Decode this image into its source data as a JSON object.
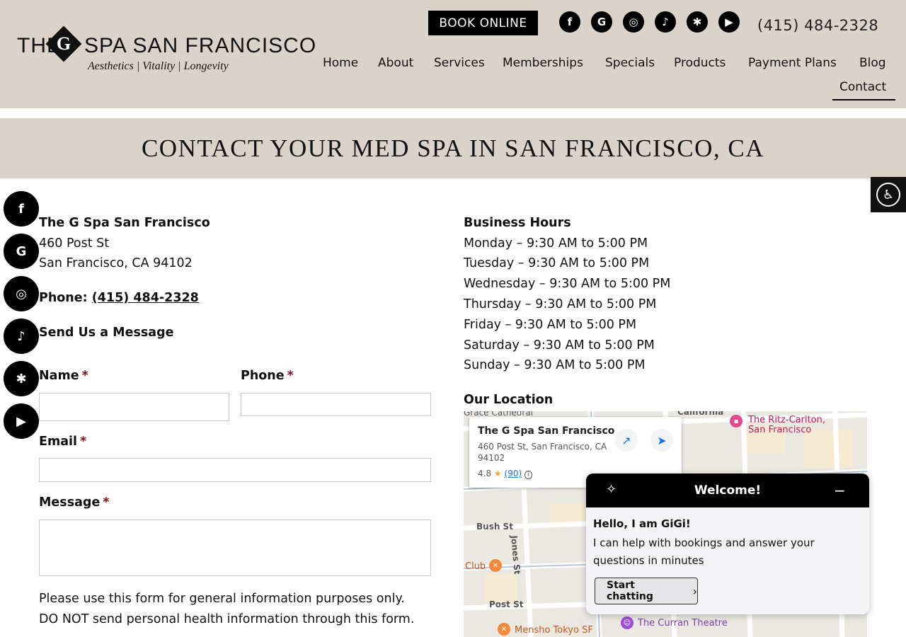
{
  "header": {
    "logo": {
      "the": "THE",
      "g": "G",
      "rest": "SPA SAN FRANCISCO",
      "tagline": "Aesthetics | Vitality | Longevity"
    },
    "book_online": "BOOK ONLINE",
    "phone": "(415) 484-2328",
    "social_icons": [
      {
        "name": "facebook-icon",
        "glyph": "f"
      },
      {
        "name": "google-icon",
        "glyph": "G"
      },
      {
        "name": "instagram-icon",
        "glyph": "◎"
      },
      {
        "name": "tiktok-icon",
        "glyph": "♪"
      },
      {
        "name": "yelp-icon",
        "glyph": "✱"
      },
      {
        "name": "youtube-icon",
        "glyph": "▶"
      }
    ],
    "nav": {
      "home": "Home",
      "about": "About",
      "services": "Services",
      "memberships": "Memberships",
      "specials": "Specials",
      "products": "Products",
      "payment_plans": "Payment Plans",
      "blog": "Blog",
      "contact": "Contact"
    }
  },
  "banner": {
    "title": "CONTACT YOUR MED SPA IN SAN FRANCISCO, CA"
  },
  "contact": {
    "business_name": "The G Spa San Francisco",
    "address_line1": "460 Post St",
    "address_line2": "San Francisco, CA 94102",
    "phone_label": "Phone:",
    "phone": "(415) 484-2328",
    "form_heading": "Send Us a Message"
  },
  "form": {
    "name_label": "Name",
    "phone_label": "Phone",
    "email_label": "Email",
    "message_label": "Message",
    "required_mark": "*",
    "notice_line1": "Please use this form for general information purposes only.",
    "notice_line2": "DO NOT send personal health information through this form."
  },
  "hours": {
    "heading": "Business Hours",
    "days": [
      "Monday – 9:30 AM to 5:00 PM",
      "Tuesday – 9:30 AM to 5:00 PM",
      "Wednesday – 9:30 AM to 5:00 PM",
      "Thursday – 9:30 AM to 5:00 PM",
      "Friday – 9:30 AM to 5:00 PM",
      "Saturday – 9:30 AM to 5:00 PM",
      "Sunday – 9:30 AM to 5:00 PM"
    ]
  },
  "location": {
    "heading": "Our Location",
    "card": {
      "title": "The G Spa San Francisco",
      "address": "460 Post St, San Francisco, CA 94102",
      "rating": "4.8",
      "reviews": "(90)"
    },
    "labels": {
      "grace": "Grace Cathedral",
      "california": "California",
      "ritz1": "The Ritz-Carlton,",
      "ritz2": "San Francisco",
      "bush": "Bush St",
      "jones": "Jones St",
      "club": "Club",
      "post": "Post St",
      "mensho": "Mensho Tokyo SF",
      "curran": "The Curran Theatre"
    }
  },
  "chat": {
    "title": "Welcome!",
    "hello": "Hello, I am GiGi!",
    "message": "I can help with bookings and answer your questions in minutes",
    "start": "Start chatting"
  },
  "colors": {
    "header_bg": "#dbd2ca",
    "accent": "#000000",
    "required": "#7a1010"
  }
}
